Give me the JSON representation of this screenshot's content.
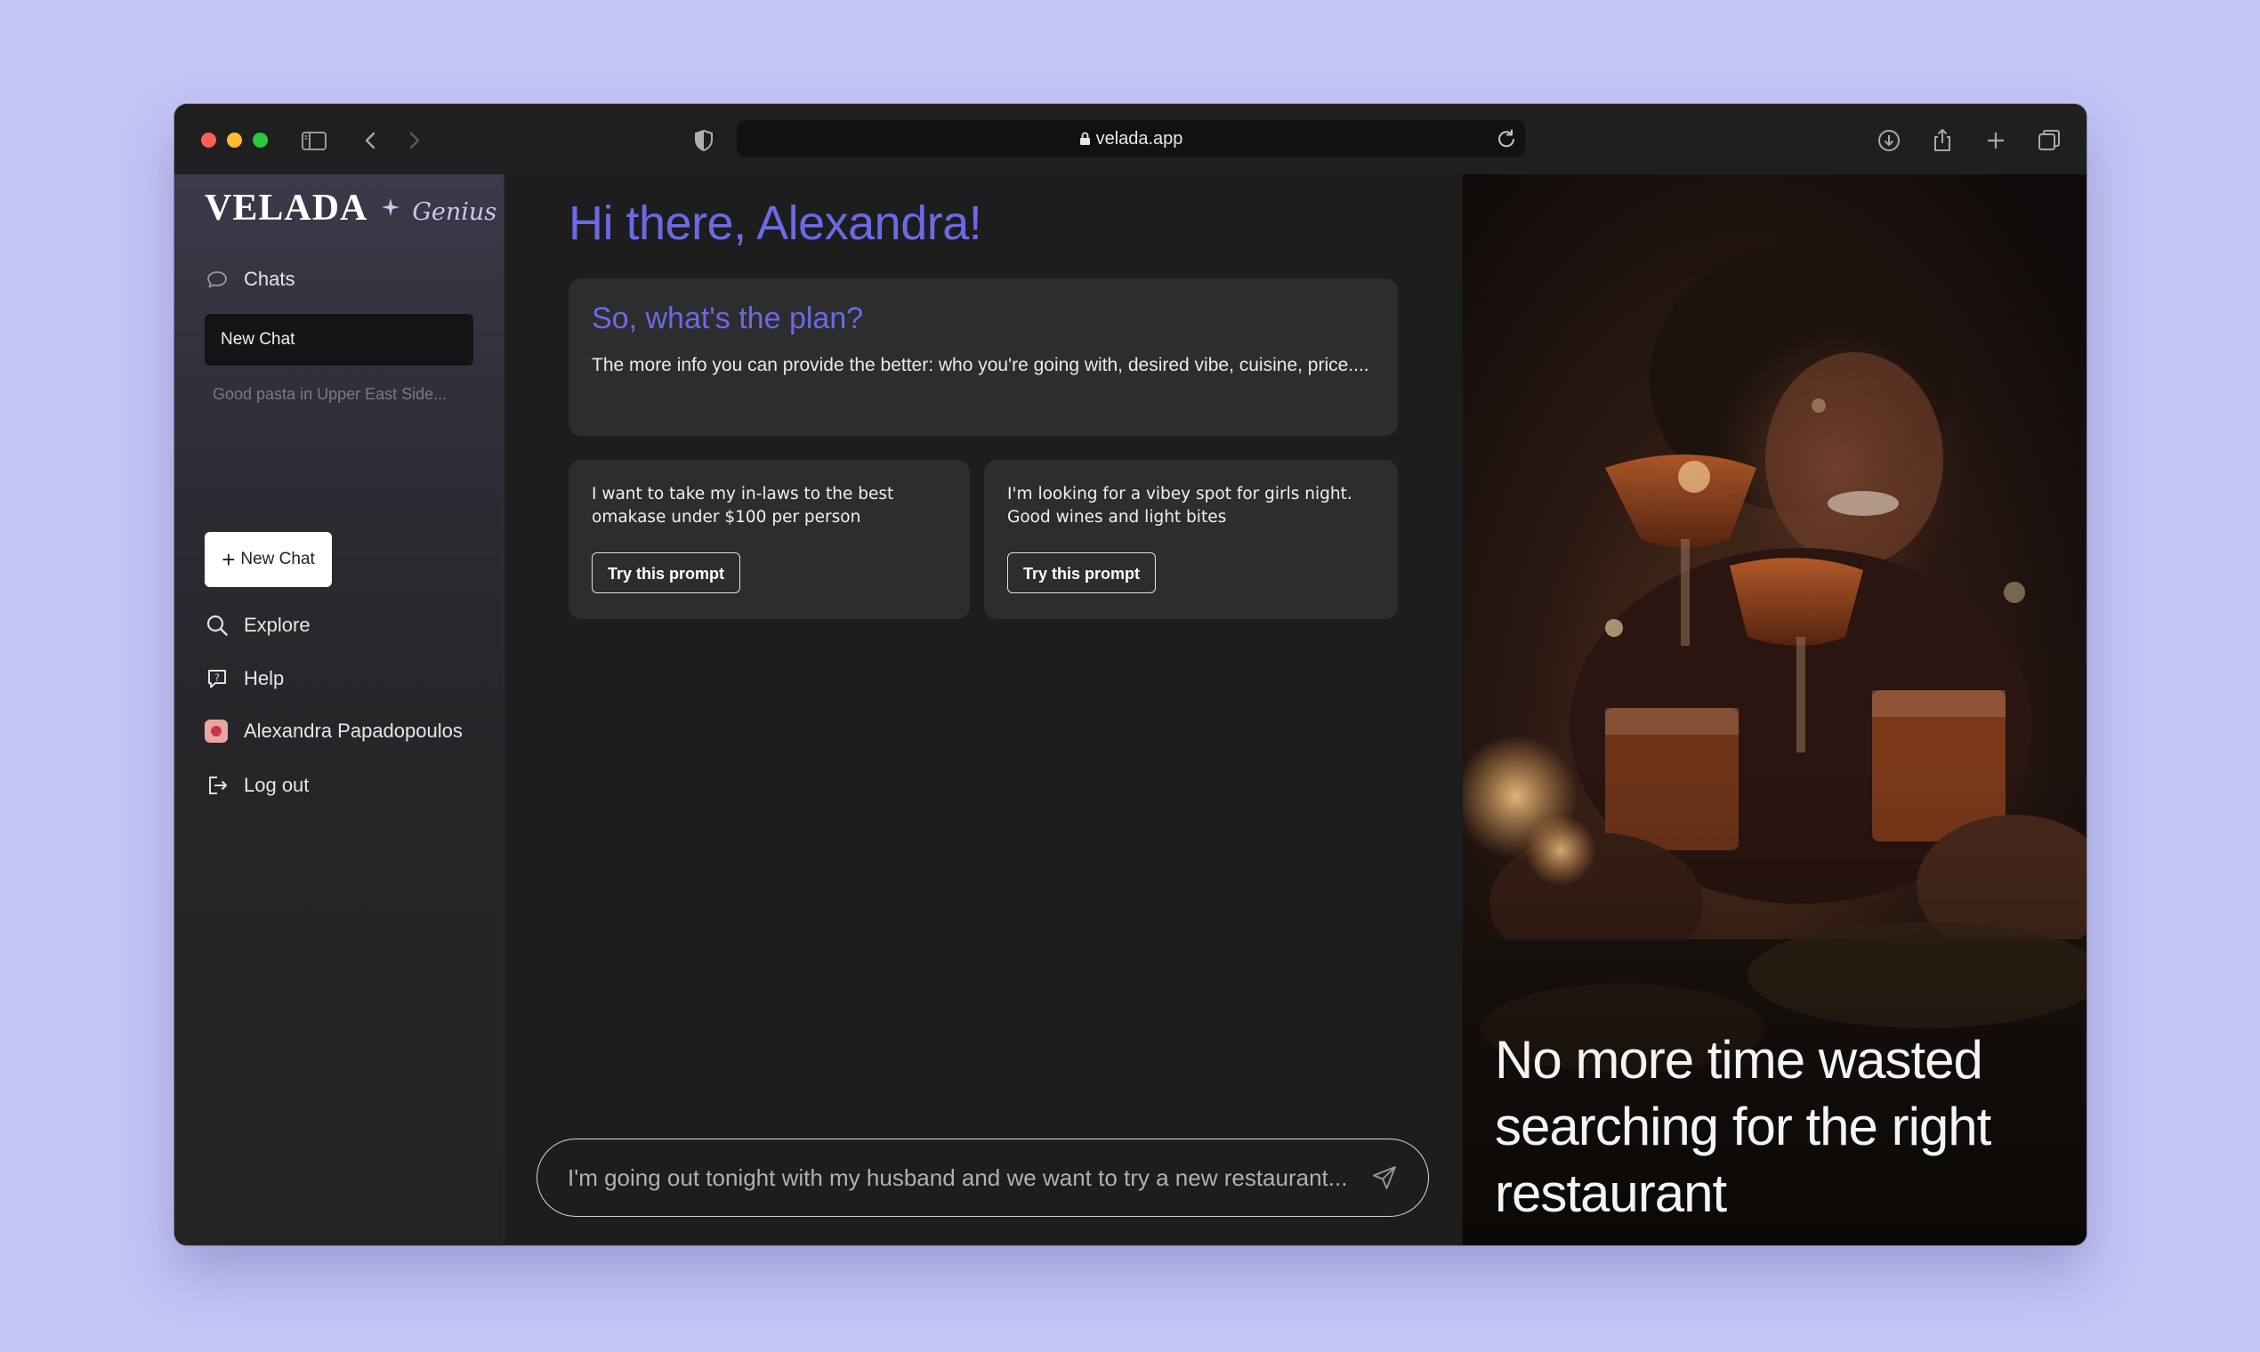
{
  "browser": {
    "url": "velada.app",
    "icons": [
      "sidebar-toggle-icon",
      "back-icon",
      "forward-icon",
      "shield-icon",
      "lock-icon",
      "reload-icon",
      "download-icon",
      "share-icon",
      "new-tab-icon",
      "tabs-overview-icon"
    ]
  },
  "sidebar": {
    "logo_main": "VELADA",
    "logo_sub": "Genius",
    "chats_label": "Chats",
    "active_chat": "New Chat",
    "recent_chat": "Good pasta in Upper East Side...",
    "new_chat_button": "New Chat",
    "nav": {
      "explore": "Explore",
      "help": "Help",
      "user_name": "Alexandra Papadopoulos",
      "logout": "Log out"
    }
  },
  "main": {
    "greeting": "Hi there, Alexandra!",
    "plan_title": "So, what's the plan?",
    "plan_description": "The more info you can provide the better: who you're going with, desired vibe, cuisine, price....",
    "prompts": [
      {
        "text": "I want to take my in-laws to the best omakase under $100 per person",
        "button": "Try this prompt"
      },
      {
        "text": "I'm looking for a vibey spot for girls night. Good wines and light bites",
        "button": "Try this prompt"
      }
    ],
    "input_placeholder": "I'm going out tonight with my husband and we want to try a new restaurant..."
  },
  "hero": {
    "caption": "No more time wasted searching for the right restaurant"
  },
  "colors": {
    "accent": "#6a6ae6",
    "background": "#c4c4f5"
  }
}
